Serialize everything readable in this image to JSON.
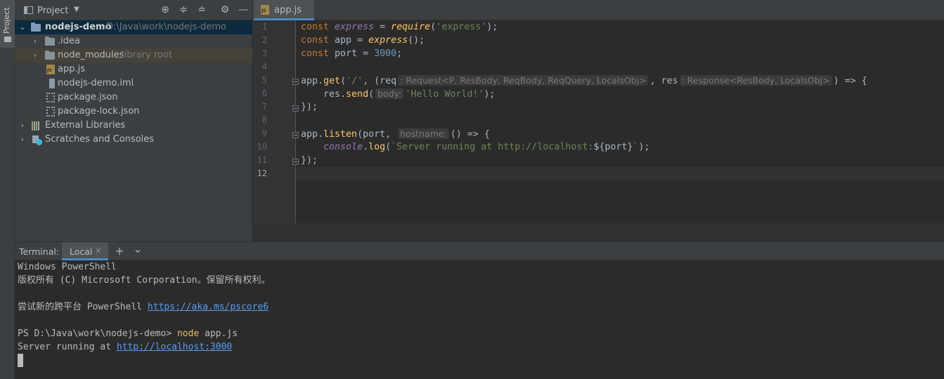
{
  "tool_strip": {
    "project_tab_label": "Project"
  },
  "project_panel": {
    "title": "Project",
    "tree": [
      {
        "label": "nodejs-demo",
        "hint": "D:\\Java\\work\\nodejs-demo",
        "icon": "module-folder-icon",
        "expanded": true,
        "selected": true
      },
      {
        "label": ".idea",
        "icon": "folder-icon",
        "expanded": false
      },
      {
        "label": "node_modules",
        "hint": "library root",
        "icon": "folder-icon",
        "expanded": false
      },
      {
        "label": "app.js",
        "icon": "javascript-file-icon"
      },
      {
        "label": "nodejs-demo.iml",
        "icon": "iml-file-icon"
      },
      {
        "label": "package.json",
        "icon": "json-file-icon"
      },
      {
        "label": "package-lock.json",
        "icon": "json-file-icon"
      },
      {
        "label": "External Libraries",
        "icon": "libraries-icon",
        "expanded": false
      },
      {
        "label": "Scratches and Consoles",
        "icon": "scratches-icon",
        "expanded": false
      }
    ]
  },
  "editor": {
    "tab_label": "app.js",
    "line_numbers": [
      "1",
      "2",
      "3",
      "4",
      "5",
      "6",
      "7",
      "8",
      "9",
      "10",
      "11",
      "12"
    ],
    "current_line": "12",
    "l1": {
      "t1": "const ",
      "t2": "express",
      "t3": " = ",
      "t4": "require",
      "t5": "(",
      "t6": "'express'",
      "t7": ");"
    },
    "l2": {
      "t1": "const ",
      "t2": "app = ",
      "t3": "express",
      "t4": "();"
    },
    "l3": {
      "t1": "const ",
      "t2": "port = ",
      "t3": "3000",
      "t4": ";"
    },
    "l5": {
      "t1": "app.",
      "t2": "get",
      "t3": "(",
      "t4": "'/'",
      "t5": ", (req",
      "h1": ": Request<P, ResBody, ReqBody, ReqQuery, LocalsObj>",
      "t6": ", res",
      "h2": ": Response<ResBody, LocalsObj>",
      "t7": ") => {"
    },
    "l6": {
      "t1": "    res.",
      "t2": "send",
      "t3": "(",
      "h1": "body:",
      "t4": "'Hello World!'",
      "t5": ");"
    },
    "l7": {
      "t1": "});"
    },
    "l9": {
      "t1": "app.",
      "t2": "listen",
      "t3": "(port, ",
      "h1": "hostname:",
      "t4": "() => {"
    },
    "l10": {
      "t1": "    ",
      "t2": "console",
      "t3": ".",
      "t4": "log",
      "t5": "(",
      "t6": "`Server running at http://localhost:",
      "t7": "${port}",
      "t8": "`",
      "t9": ");"
    },
    "l11": {
      "t1": "});"
    }
  },
  "terminal": {
    "title": "Terminal:",
    "tab_label": "Local",
    "close_glyph": "×",
    "add_glyph": "+",
    "more_glyph": "⌄",
    "lines": {
      "l1": "Windows PowerShell",
      "l2": "版权所有 (C) Microsoft Corporation。保留所有权利。",
      "l4_text": "尝试新的跨平台 PowerShell ",
      "l4_link": "https://aka.ms/pscore6",
      "l6_prompt": "PS D:\\Java\\work\\nodejs-demo> ",
      "l6_cmd": "node",
      "l6_arg": " app.js",
      "l7_text": "Server running at ",
      "l7_link": "http://localhost:3000"
    }
  },
  "colors": {
    "accent": "#4a88c7",
    "keyword": "#cc7832",
    "string": "#6a8759",
    "number": "#6897bb",
    "function": "#ffc66d",
    "link": "#589df6"
  }
}
